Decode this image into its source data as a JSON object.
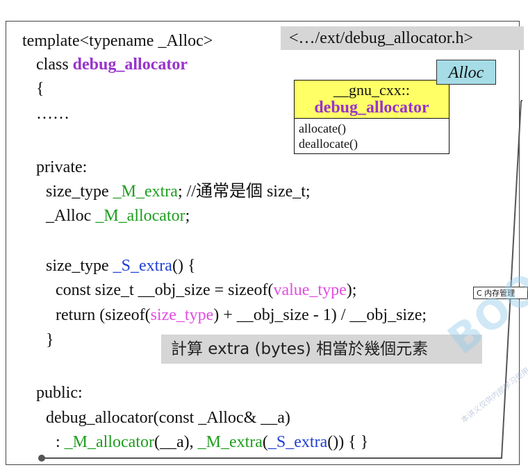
{
  "header_tag": "<…/ext/debug_allocator.h>",
  "alloc_tag": "Alloc",
  "uml": {
    "namespace": "__gnu_cxx::",
    "class_name": "debug_allocator",
    "operations": [
      "allocate()",
      "deallocate()"
    ]
  },
  "code": {
    "l1": "template<typename _Alloc>",
    "l2_kw": "class ",
    "l2_name": "debug_allocator",
    "l3": "{",
    "l4": "……",
    "l5": "private:",
    "l6_a": "size_type ",
    "l6_b": "_M_extra",
    "l6_c": "; //通常是個 size_t;",
    "l7_a": "_Alloc ",
    "l7_b": "_M_allocator",
    "l7_c": ";",
    "l8_a": "size_type ",
    "l8_b": "_S_extra",
    "l8_c": "()   {",
    "l9_a": "const size_t __obj_size = sizeof(",
    "l9_b": "value_type",
    "l9_c": ");",
    "l10_a": "return (sizeof(",
    "l10_b": "size_type",
    "l10_c": ") + __obj_size - 1) / __obj_size;",
    "l11": "}",
    "l12": "public:",
    "l13": "debug_allocator(const _Alloc& __a)",
    "l14_a": ": ",
    "l14_b": "_M_allocator",
    "l14_c": "(__a), ",
    "l14_d": "_M_extra",
    "l14_e": "(",
    "l14_f": "_S_extra",
    "l14_g": "()) { }"
  },
  "note": "計算 extra (bytes) 相當於幾個元素",
  "cross_ref": "C 内存管理",
  "watermark": "BOOC",
  "watermark_sub": "本讲义仅供内部学习使用",
  "colors": {
    "purple": "#9933cc",
    "green": "#1e9e1e",
    "blue": "#1f3fd6",
    "magenta": "#e14de1",
    "uml_header": "#ffff66",
    "alloc_tag": "#a5dce6",
    "gray_box": "#d6d6d6"
  }
}
